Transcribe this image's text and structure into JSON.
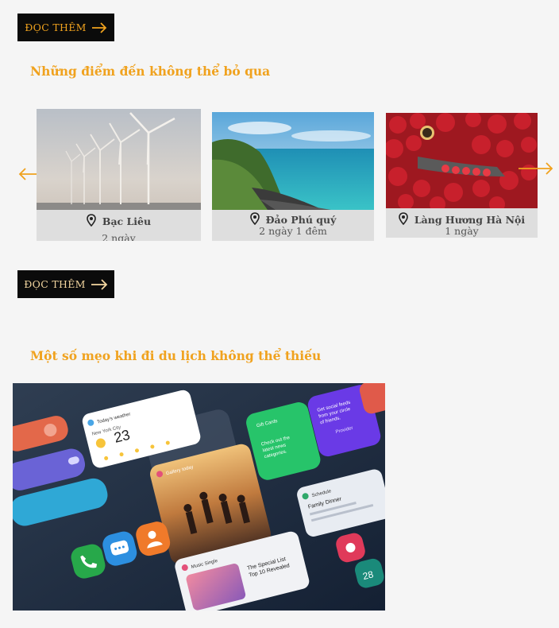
{
  "read_more_top": {
    "label": "ĐỌC THÊM"
  },
  "destinations": {
    "heading": "Những điểm đến không thể bỏ qua",
    "cards": [
      {
        "title": "Bạc Liêu",
        "duration": "2 ngày"
      },
      {
        "title": "Đảo Phú quý",
        "duration": "2 ngày 1 đêm"
      },
      {
        "title": "Làng Hương Hà Nội",
        "duration": "1 ngày"
      }
    ]
  },
  "read_more_mid": {
    "label": "ĐỌC THÊM"
  },
  "tips": {
    "heading": "Một số mẹo khi đi du lịch không thể thiếu",
    "image_texts": {
      "weather_title": "Today's weather",
      "weather_city": "New York City",
      "weather_temp": "23",
      "gallery_title": "Gallery today",
      "cards_title": "Gift Cards",
      "cards_text": "Check out the latest news categories.",
      "social_text": "Get social feeds from your circle of friends.",
      "social_link": "Provider",
      "schedule_title": "Schedule",
      "schedule_event": "Family Dinner",
      "music_title": "Music Single",
      "music_text": "The Special List Top 10 Revealed",
      "calendar_day": "28"
    }
  },
  "colors": {
    "accent": "#f0a21e",
    "button_bg": "#0b0b0b",
    "card_bg": "#dedede",
    "page_bg": "#f5f5f5"
  },
  "icons": {
    "button_arrow": "arrow-right-icon",
    "location": "map-pin-icon",
    "carousel_prev": "arrow-left-icon",
    "carousel_next": "arrow-right-icon"
  }
}
